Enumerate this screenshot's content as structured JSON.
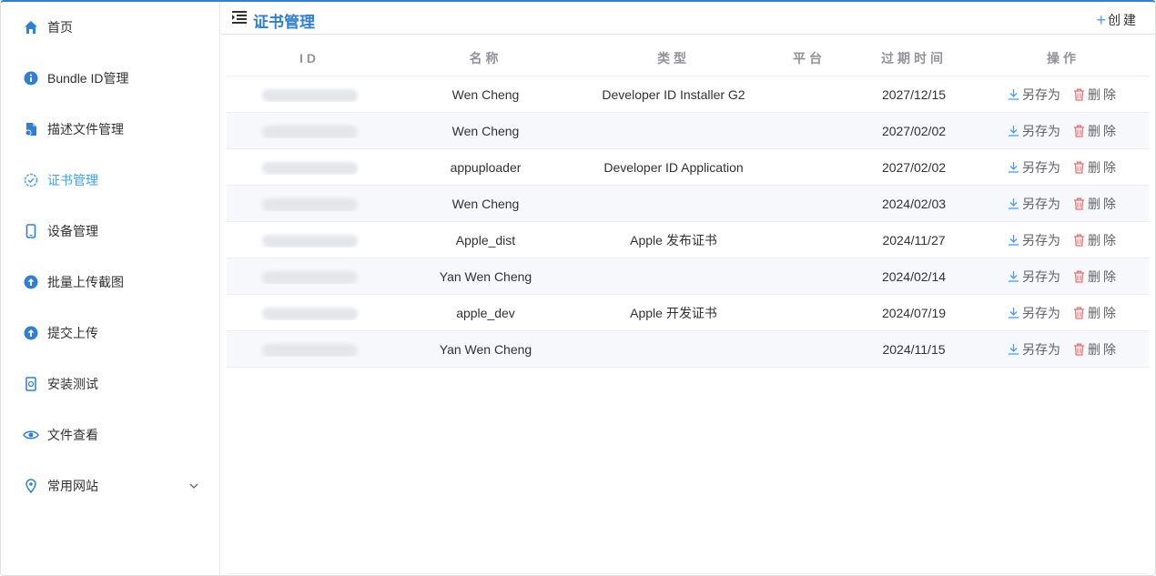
{
  "sidebar": {
    "items": [
      {
        "label": "首页",
        "icon": "home-icon"
      },
      {
        "label": "Bundle ID管理",
        "icon": "info-icon"
      },
      {
        "label": "描述文件管理",
        "icon": "file-icon"
      },
      {
        "label": "证书管理",
        "icon": "badge-check-icon",
        "active": true
      },
      {
        "label": "设备管理",
        "icon": "phone-icon"
      },
      {
        "label": "批量上传截图",
        "icon": "upload-icon"
      },
      {
        "label": "提交上传",
        "icon": "upload-icon"
      },
      {
        "label": "安装测试",
        "icon": "install-icon"
      },
      {
        "label": "文件查看",
        "icon": "eye-icon"
      },
      {
        "label": "常用网站",
        "icon": "location-icon",
        "expandable": true
      }
    ]
  },
  "header": {
    "title": "证书管理",
    "create_label": "创建"
  },
  "table": {
    "columns": [
      "ID",
      "名称",
      "类型",
      "平台",
      "过期时间",
      "操作"
    ],
    "save_label": "另存为",
    "delete_label": "删除",
    "rows": [
      {
        "name": "Wen Cheng",
        "type": "Developer ID Installer G2",
        "platform": "",
        "expires": "2027/12/15"
      },
      {
        "name": "Wen Cheng",
        "type": "",
        "platform": "",
        "expires": "2027/02/02"
      },
      {
        "name": "appuploader",
        "type": "Developer ID Application",
        "platform": "",
        "expires": "2027/02/02"
      },
      {
        "name": "Wen Cheng",
        "type": "",
        "platform": "",
        "expires": "2024/02/03"
      },
      {
        "name": "Apple_dist",
        "type": "Apple 发布证书",
        "platform": "",
        "expires": "2024/11/27"
      },
      {
        "name": "Yan Wen Cheng",
        "type": "",
        "platform": "",
        "expires": "2024/02/14"
      },
      {
        "name": "apple_dev",
        "type": "Apple 开发证书",
        "platform": "",
        "expires": "2024/07/19"
      },
      {
        "name": "Yan Wen Cheng",
        "type": "",
        "platform": "",
        "expires": "2024/11/15"
      }
    ]
  },
  "colors": {
    "accent": "#2f7fd6",
    "link": "#409eff",
    "danger": "#f56c6c",
    "annotation_arrow": "#e8322c"
  }
}
